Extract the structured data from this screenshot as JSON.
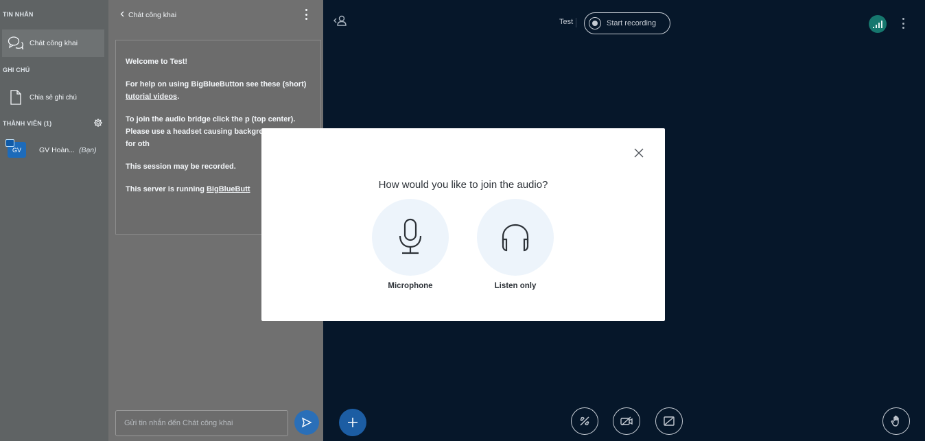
{
  "sidebar": {
    "messages_title": "TIN NHẮN",
    "public_chat_label": "Chát công khai",
    "notes_title": "GHI CHÚ",
    "shared_notes_label": "Chia sẻ ghi chú",
    "users_title": "THÀNH VIÊN (1)",
    "user": {
      "initials": "GV",
      "name": "GV Hoàn...",
      "you_label": "(Bạn)"
    }
  },
  "chat": {
    "header_title": "Chát công khai",
    "welcome": {
      "line1": "Welcome to Test!",
      "line2_pre": "For help on using BigBlueButton see these (short) ",
      "line2_link": "tutorial videos",
      "line2_post": ".",
      "line3": "To join the audio bridge click the p (top center). Please use a headset causing background noise for oth",
      "line4": "This session may be recorded.",
      "line5_pre": "This server is running ",
      "line5_link": "BigBlueButt"
    },
    "input_placeholder": "Gửi tin nhắn đến Chát công khai"
  },
  "main": {
    "meeting_title": "Test",
    "record_label": "Start recording",
    "icons": [
      "users-toggle-icon",
      "record-icon",
      "connection-status-icon",
      "options-icon",
      "plus-icon",
      "audio-icon",
      "video-icon",
      "screenshare-icon",
      "raise-hand-icon"
    ]
  },
  "modal": {
    "title": "How would you like to join the audio?",
    "microphone_label": "Microphone",
    "listen_only_label": "Listen only"
  },
  "colors": {
    "sidebar_bg": "#5F6364",
    "chat_bg": "#707070",
    "main_bg": "#06172A",
    "primary": "#1C5DA3",
    "connection_green": "#16776E",
    "modal_bg": "#FFFFFF",
    "option_circle": "#EDF4FB"
  }
}
